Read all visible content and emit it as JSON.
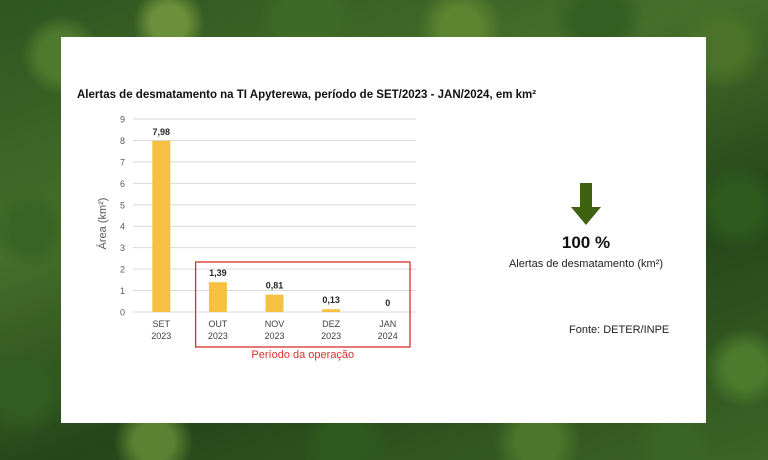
{
  "chart_data": {
    "type": "bar",
    "title": "Alertas de desmatamento na TI Apyterewa, período de SET/2023 - JAN/2024, em km²",
    "ylabel": "Área (km²)",
    "xlabel": "",
    "categories": [
      [
        "SET",
        "2023"
      ],
      [
        "OUT",
        "2023"
      ],
      [
        "NOV",
        "2023"
      ],
      [
        "DEZ",
        "2023"
      ],
      [
        "JAN",
        "2024"
      ]
    ],
    "values": [
      7.98,
      1.39,
      0.81,
      0.13,
      0
    ],
    "value_labels": [
      "7,98",
      "1,39",
      "0,81",
      "0,13",
      "0"
    ],
    "ylim": [
      0,
      9
    ],
    "yticks": [
      0,
      1,
      2,
      3,
      4,
      5,
      6,
      7,
      8,
      9
    ],
    "grid": true,
    "bar_color": "#f6c143",
    "highlight": {
      "label": "Período da operação",
      "categories": [
        "OUT",
        "NOV",
        "DEZ",
        "JAN"
      ],
      "color": "#d9302b"
    }
  },
  "summary": {
    "percent": "100 %",
    "label": "Alertas de desmatamento (km²)",
    "icon": "arrow-down-icon",
    "icon_color": "#3f6212"
  },
  "source": "Fonte: DETER/INPE"
}
